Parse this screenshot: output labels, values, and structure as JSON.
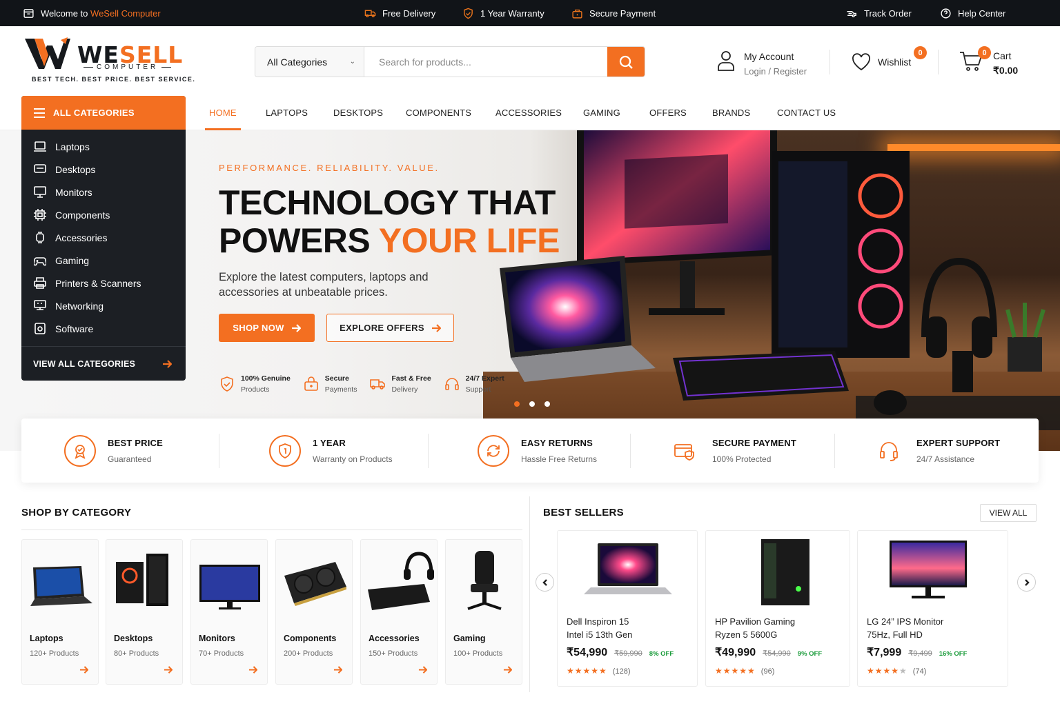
{
  "topbar": {
    "welcome_prefix": "Welcome to",
    "welcome_brand": "WeSell Computer",
    "free_delivery": "Free Delivery",
    "warranty": "1 Year Warranty",
    "secure_payment": "Secure Payment",
    "track_order": "Track Order",
    "help_center": "Help Center"
  },
  "brand": {
    "name_part1": "WE",
    "name_part2": "SELL",
    "subname": "COMPUTER",
    "tagline": "BEST TECH. BEST PRICE. BEST SERVICE."
  },
  "search": {
    "category": "All Categories",
    "placeholder": "Search for products..."
  },
  "account": {
    "title": "My Account",
    "subtitle": "Login / Register"
  },
  "wishlist": {
    "label": "Wishlist",
    "count": "0"
  },
  "cart": {
    "label": "Cart",
    "total": "₹0.00",
    "count": "0"
  },
  "categories_panel": {
    "header": "ALL CATEGORIES",
    "items": [
      {
        "label": "Laptops",
        "icon": "laptop-icon"
      },
      {
        "label": "Desktops",
        "icon": "desktop-icon"
      },
      {
        "label": "Monitors",
        "icon": "monitor-icon"
      },
      {
        "label": "Components",
        "icon": "chip-icon"
      },
      {
        "label": "Accessories",
        "icon": "accessory-icon"
      },
      {
        "label": "Gaming",
        "icon": "gamepad-icon"
      },
      {
        "label": "Printers & Scanners",
        "icon": "printer-icon"
      },
      {
        "label": "Networking",
        "icon": "network-icon"
      },
      {
        "label": "Software",
        "icon": "software-icon"
      }
    ],
    "view_all": "VIEW ALL CATEGORIES"
  },
  "nav": {
    "items": [
      "HOME",
      "LAPTOPS",
      "DESKTOPS",
      "COMPONENTS",
      "ACCESSORIES",
      "GAMING",
      "OFFERS",
      "BRANDS",
      "CONTACT US"
    ],
    "active": "HOME"
  },
  "hero": {
    "eyebrow": "PERFORMANCE. RELIABILITY. VALUE.",
    "headline_line1": "TECHNOLOGY THAT",
    "headline_line2_a": "POWERS",
    "headline_line2_b": "YOUR LIFE",
    "subtext": "Explore the latest computers, laptops and accessories at unbeatable prices.",
    "shop_now": "SHOP NOW",
    "explore_offers": "EXPLORE OFFERS",
    "badges": [
      {
        "title": "100% Genuine",
        "sub": "Products",
        "icon": "shield-check-icon"
      },
      {
        "title": "Secure",
        "sub": "Payments",
        "icon": "lock-icon"
      },
      {
        "title": "Fast & Free",
        "sub": "Delivery",
        "icon": "truck-icon"
      },
      {
        "title": "24/7 Expert",
        "sub": "Support",
        "icon": "headset-icon"
      }
    ],
    "slide_count": 3,
    "active_slide": 1
  },
  "features": [
    {
      "title": "BEST PRICE",
      "sub": "Guaranteed",
      "icon": "award-icon"
    },
    {
      "title": "1 YEAR",
      "sub": "Warranty on Products",
      "icon": "shield-icon"
    },
    {
      "title": "EASY RETURNS",
      "sub": "Hassle Free Returns",
      "icon": "returns-icon"
    },
    {
      "title": "SECURE PAYMENT",
      "sub": "100% Protected",
      "icon": "card-shield-icon"
    },
    {
      "title": "EXPERT SUPPORT",
      "sub": "24/7 Assistance",
      "icon": "headset-icon"
    }
  ],
  "shop_by_category": {
    "title": "SHOP BY CATEGORY",
    "cards": [
      {
        "name": "Laptops",
        "count": "120+ Products"
      },
      {
        "name": "Desktops",
        "count": "80+ Products"
      },
      {
        "name": "Monitors",
        "count": "70+ Products"
      },
      {
        "name": "Components",
        "count": "200+ Products"
      },
      {
        "name": "Accessories",
        "count": "150+ Products"
      },
      {
        "name": "Gaming",
        "count": "100+ Products"
      }
    ]
  },
  "best_sellers": {
    "title": "BEST SELLERS",
    "view_all": "VIEW ALL",
    "products": [
      {
        "name_line1": "Dell Inspiron 15",
        "name_line2": "Intel i5 13th Gen",
        "price": "₹54,990",
        "mrp": "₹59,990",
        "off": "8% OFF",
        "rating": 5,
        "stars": "★★★★★",
        "reviews": "(128)"
      },
      {
        "name_line1": "HP Pavilion Gaming",
        "name_line2": "Ryzen 5 5600G",
        "price": "₹49,990",
        "mrp": "₹54,990",
        "off": "9% OFF",
        "rating": 5,
        "stars": "★★★★★",
        "reviews": "(96)"
      },
      {
        "name_line1": "LG 24” IPS Monitor",
        "name_line2": "75Hz, Full HD",
        "price": "₹7,999",
        "mrp": "₹9,499",
        "off": "16% OFF",
        "rating": 4,
        "stars": "★★★★",
        "stars_empty": "★",
        "reviews": "(74)"
      }
    ]
  },
  "colors": {
    "accent": "#f36f21",
    "dark": "#1c1f24",
    "topbar": "#111418",
    "discount": "#1a9b3a"
  }
}
